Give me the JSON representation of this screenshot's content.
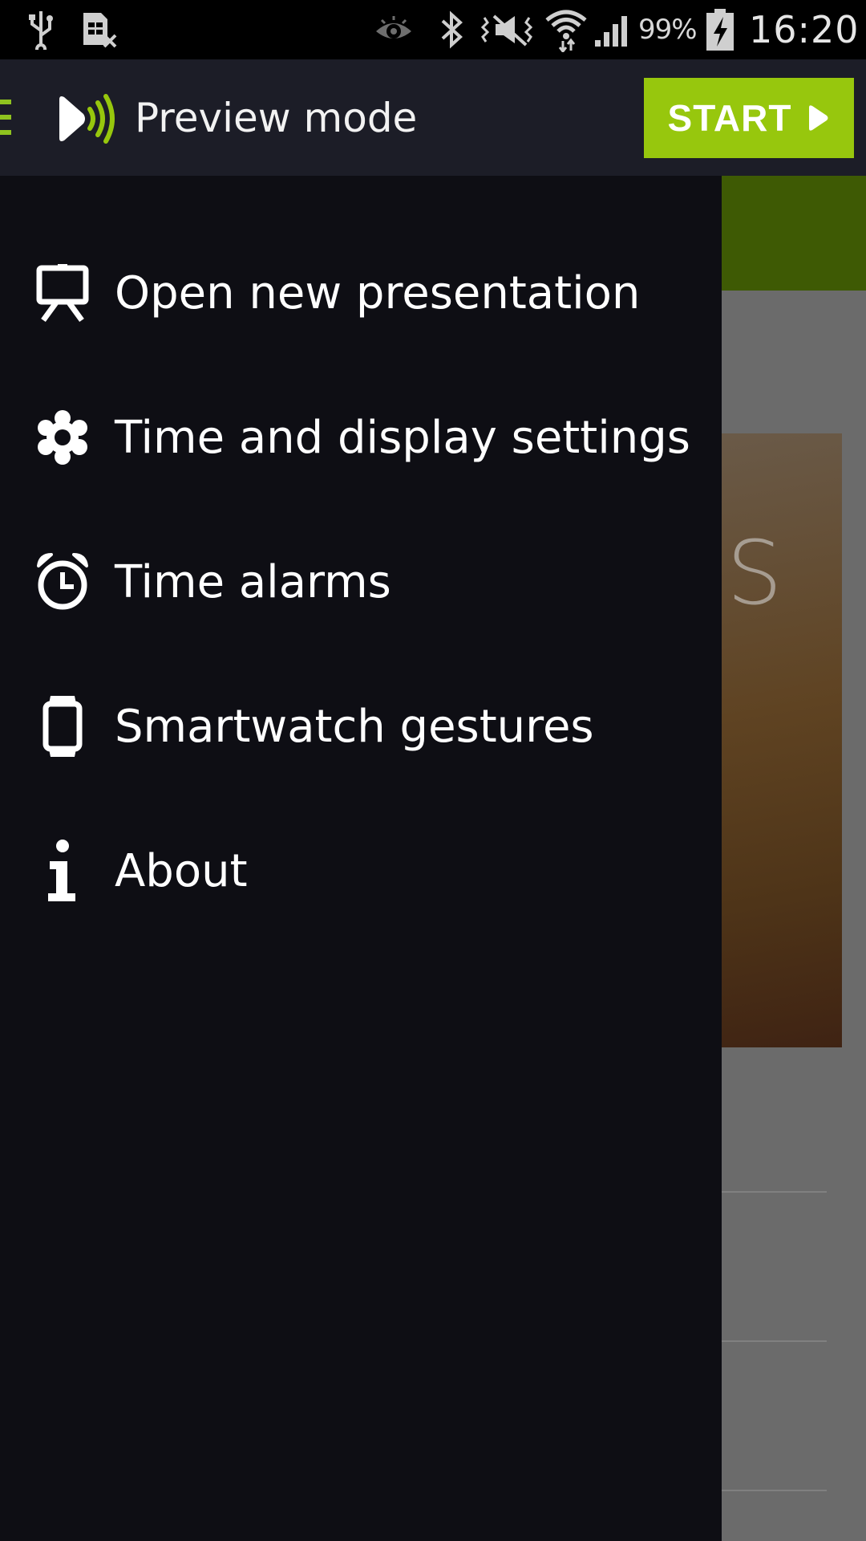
{
  "status_bar": {
    "battery_percent": "99%",
    "time": "16:20",
    "icons": [
      "usb-icon",
      "sim-missing-icon",
      "eye-icon",
      "bluetooth-icon",
      "mute-icon",
      "wifi-icon",
      "signal-icon",
      "battery-charging-icon"
    ]
  },
  "action_bar": {
    "title": "Preview mode",
    "start_label": "START",
    "accent_color": "#97c70d"
  },
  "drawer": {
    "items": [
      {
        "label": "Open new presentation",
        "icon": "presentation-icon"
      },
      {
        "label": "Time and display settings",
        "icon": "gear-icon"
      },
      {
        "label": "Time alarms",
        "icon": "alarm-clock-icon"
      },
      {
        "label": "Smartwatch gestures",
        "icon": "smartwatch-icon"
      },
      {
        "label": "About",
        "icon": "info-icon"
      }
    ]
  }
}
